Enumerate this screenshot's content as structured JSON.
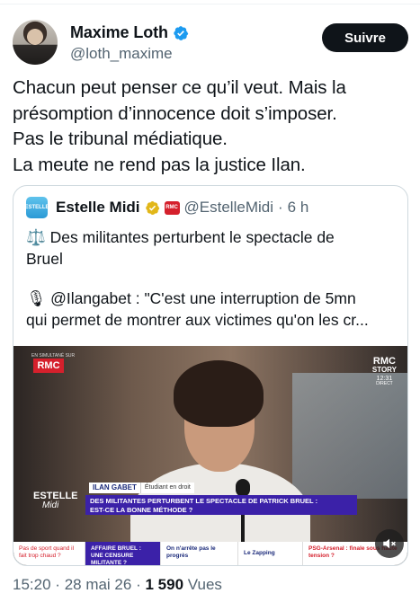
{
  "author": {
    "display_name": "Maxime Loth",
    "handle": "@loth_maxime",
    "follow_label": "Suivre",
    "verified_color": "#1d9bf0"
  },
  "tweet": {
    "lines": [
      "Chacun peut penser ce qu’il veut. Mais la",
      "présomption d’innocence doit s’imposer.",
      "Pas le tribunal médiatique.",
      "La meute ne rend pas la justice Ilan."
    ]
  },
  "quote": {
    "avatar_text": "ESTELLE",
    "display_name": "Estelle Midi",
    "badge_text": "RMC",
    "handle": "@EstelleMidi",
    "separator": "·",
    "time": "6 h",
    "verified_color": "#e2b719",
    "lines_a": [
      "⚖️ Des militantes perturbent le spectacle de",
      "Bruel"
    ],
    "lines_b": [
      "🎙 @Ilangabet : \"C'est une interruption de 5mn",
      "qui permet de montrer aux victimes qu'on les cr..."
    ],
    "video": {
      "channel_small": "EN SIMULTANÉ SUR",
      "channel_logo": "RMC",
      "story_1": "RMC",
      "story_2": "STORY",
      "story_time": "12:31",
      "story_live": "DIRECT",
      "guest_name": "ILAN GABET",
      "guest_role": "Étudiant en droit",
      "headline_1": "DES MILITANTES PERTURBENT LE SPECTACLE DE PATRICK BRUEL :",
      "headline_2": "EST-CE LA BONNE MÉTHODE ?",
      "show_logo_1": "ESTELLE",
      "show_logo_2": "Midi",
      "ticker": [
        "Pas de sport quand il fait trop chaud ?",
        "AFFAIRE BRUEL : UNE CENSURE MILITANTE ?",
        "On n'arrête pas le progrès",
        "Le Zapping",
        "PSG-Arsenal : finale sous haute tension ?"
      ]
    }
  },
  "meta": {
    "time": "15:20",
    "separator": "·",
    "date": "28 mai 26",
    "views_count": "1 590",
    "views_label": "Vues"
  }
}
